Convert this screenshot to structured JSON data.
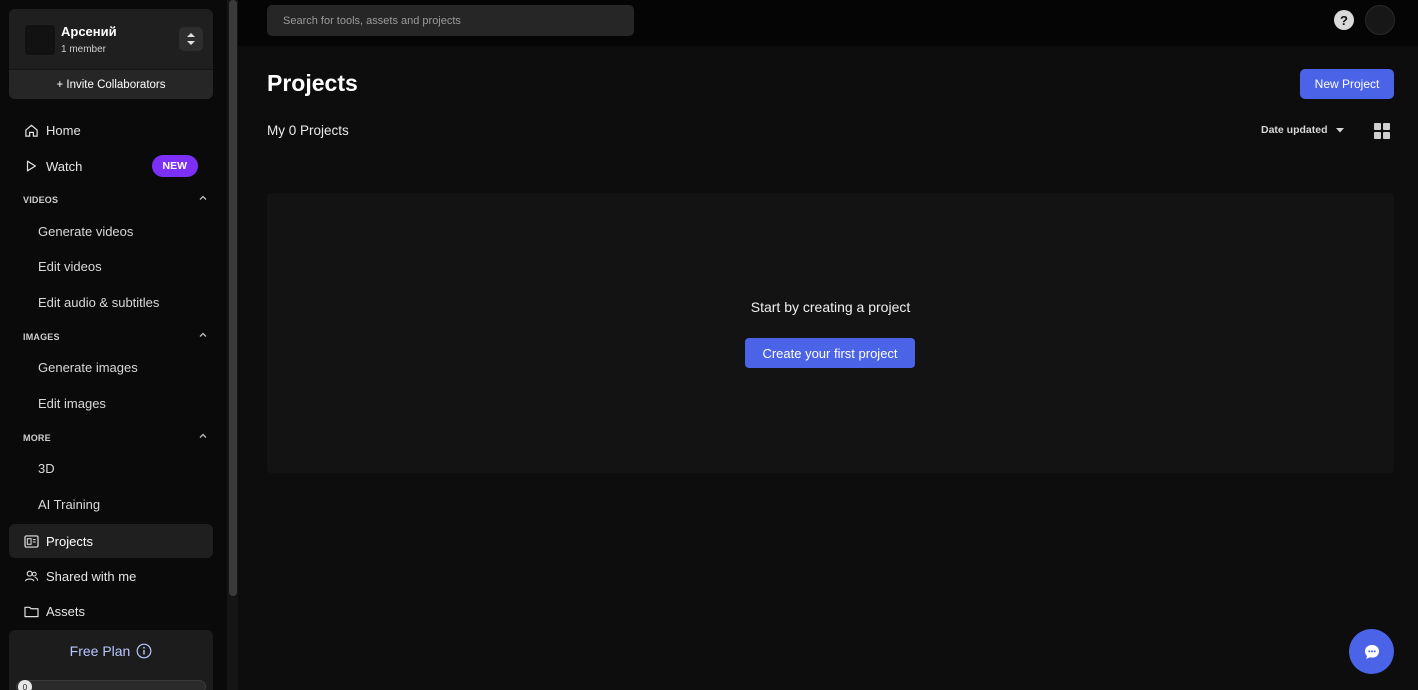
{
  "workspace": {
    "name": "Арсений",
    "members": "1 member",
    "invite_label": "+ Invite Collaborators"
  },
  "sidebar": {
    "home": "Home",
    "watch": "Watch",
    "watch_badge": "NEW",
    "sections": {
      "videos": {
        "title": "VIDEOS",
        "items": [
          "Generate videos",
          "Edit videos",
          "Edit audio & subtitles"
        ]
      },
      "images": {
        "title": "IMAGES",
        "items": [
          "Generate images",
          "Edit images"
        ]
      },
      "more": {
        "title": "MORE",
        "items": [
          "3D",
          "AI Training"
        ]
      }
    },
    "projects": "Projects",
    "shared": "Shared with me",
    "assets": "Assets"
  },
  "plan": {
    "label": "Free Plan",
    "usage_value": "0"
  },
  "search": {
    "placeholder": "Search for tools, assets and projects"
  },
  "header": {
    "help_icon_text": "?"
  },
  "main": {
    "title": "Projects",
    "new_project_label": "New Project",
    "projects_count": "My 0 Projects",
    "sort_label": "Date updated",
    "empty_text": "Start by creating a project",
    "create_first_label": "Create your first project"
  },
  "colors": {
    "accent": "#4a63e7",
    "badge": "#7b2ff7",
    "background": "#0d0d0d"
  }
}
